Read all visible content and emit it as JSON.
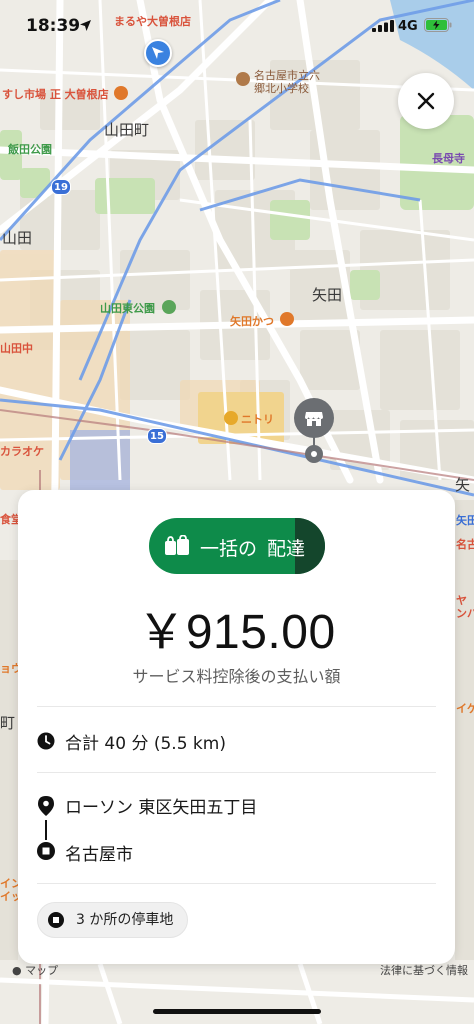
{
  "status_bar": {
    "time": "18:39",
    "network": "4G",
    "battery_color": "#2fbf3a"
  },
  "map": {
    "area_labels": {
      "yamadacho": "山田町",
      "yamada": "山田",
      "yada": "矢田",
      "yada_edge": "矢"
    },
    "poi_labels": {
      "maruya": "まるや大曽根店",
      "sushi": "すし市場 正 大曽根店",
      "school": "名古屋市立六\n郷北小学校",
      "iida_park": "飯田公園",
      "yamada_east_park": "山田東公園",
      "yada_katsu": "矢田かつ",
      "nitori": "ニトリ",
      "karaoke": "カラオケ",
      "nagakuji": "長母寺",
      "yamada_naka": "山田中",
      "shokudo": "食堂",
      "yada_east": "矢田",
      "nago": "名古",
      "ya_nba": "ヤ\nンバ",
      "ige": "イゲ",
      "ikei": "イケ",
      "ryou": "ョウ",
      "machi": "町",
      "kou": "工場",
      "iku": "イン\nイッ"
    },
    "route_badges": {
      "r19": "19",
      "r15": "15"
    },
    "colors": {
      "route_blue": "#6f9de8",
      "road_white": "#ffffff",
      "park_green": "#c8e2b4",
      "block": "#e3e0d7",
      "marker_gray": "#6b6e72",
      "location_blue": "#3a82e0"
    }
  },
  "close_button": {
    "icon": "close-icon"
  },
  "sheet": {
    "pill": {
      "label_part1": "一括の",
      "label_part2": "配達",
      "icon": "batch-bags-icon",
      "color": "#0e8b4a",
      "dark_segment_color": "#14462c"
    },
    "fare": "￥915.00",
    "fare_subtitle": "サービス料控除後の支払い額",
    "duration": {
      "icon": "clock-icon",
      "text": "合計 40 分 (5.5 km)"
    },
    "pickup": {
      "icon": "location-pin-icon",
      "text": "ローソン 東区矢田五丁目"
    },
    "dropoff": {
      "icon": "square-stop-icon",
      "text": "名古屋市"
    },
    "stops_chip": {
      "icon": "square-stop-icon",
      "text": "3 か所の停車地"
    }
  },
  "footer": {
    "maps_brand": "マップ",
    "legal": "法律に基づく情報"
  }
}
